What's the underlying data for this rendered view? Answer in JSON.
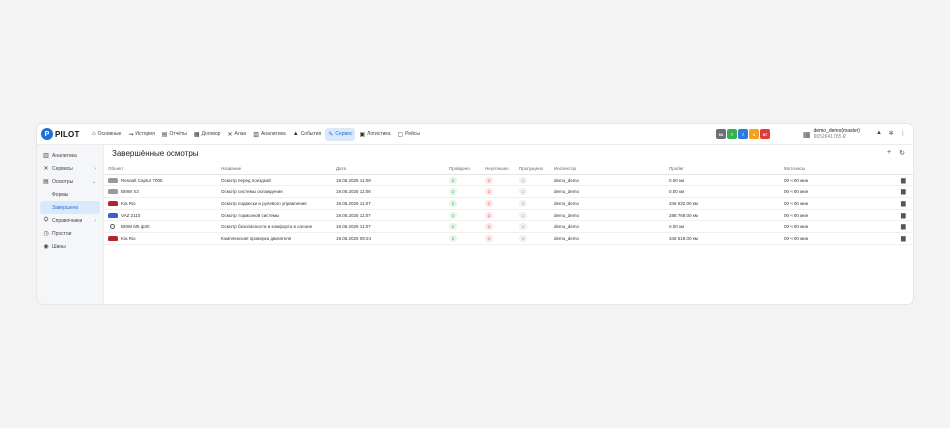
{
  "logo": {
    "mark": "P",
    "text": "PILOT"
  },
  "nav": [
    {
      "icon": "home-icon",
      "glyph": "⌂",
      "label": "Основные"
    },
    {
      "icon": "route-icon",
      "glyph": "⇝",
      "label": "История"
    },
    {
      "icon": "document-icon",
      "glyph": "▤",
      "label": "Отчёты"
    },
    {
      "icon": "contract-icon",
      "glyph": "▦",
      "label": "Договор"
    },
    {
      "icon": "tools-icon",
      "glyph": "✕",
      "label": "Алан"
    },
    {
      "icon": "analytics-icon",
      "glyph": "▥",
      "label": "Аналитика"
    },
    {
      "icon": "bell-icon",
      "glyph": "▲",
      "label": "События"
    },
    {
      "icon": "wrench-icon",
      "glyph": "✎",
      "label": "Сервис",
      "active": true
    },
    {
      "icon": "truck-icon",
      "glyph": "▣",
      "label": "Логистика"
    },
    {
      "icon": "bus-icon",
      "glyph": "▢",
      "label": "Рейсы"
    }
  ],
  "badges": [
    {
      "text": "6h",
      "color": "#6b6f78"
    },
    {
      "text": "7",
      "color": "#35b34a"
    },
    {
      "text": "7",
      "color": "#2d7be0"
    },
    {
      "text": "4",
      "color": "#f2a31a"
    },
    {
      "text": "87",
      "color": "#e33b3b"
    }
  ],
  "user": {
    "name": "demo_demo(master)",
    "balance": "9652641785 ₽"
  },
  "sidebar": [
    {
      "icon": "analytics-icon",
      "glyph": "▥",
      "label": "Аналитика"
    },
    {
      "icon": "tools-icon",
      "glyph": "✕",
      "label": "Сервисы",
      "chevron": "›"
    },
    {
      "icon": "document-icon",
      "glyph": "▤",
      "label": "Осмотры",
      "chevron": "⌄"
    },
    {
      "label": "Формы",
      "sub": true
    },
    {
      "label": "Завершено",
      "sub": true,
      "selected": true
    },
    {
      "icon": "directory-icon",
      "glyph": "⛭",
      "label": "Справочники",
      "chevron": "›"
    },
    {
      "icon": "clock-icon",
      "glyph": "◷",
      "label": "Простои"
    },
    {
      "icon": "tire-icon",
      "glyph": "◉",
      "label": "Шины"
    }
  ],
  "page": {
    "title": "Завершённые осмотры",
    "add": "+",
    "refresh": "↻"
  },
  "table": {
    "headers": [
      "Объект",
      "Название",
      "Дата",
      "Пройдено",
      "Неуспешно",
      "Пропущено",
      "Инспектор",
      "Пробег",
      "Моточасы"
    ],
    "rows": [
      {
        "car_color": "#9a9a9a",
        "object": "Renault Captur 7005",
        "name": "Осмотр перед поездкой",
        "date": "19.05.2025 11:09",
        "passed": "2",
        "failed": "2",
        "skipped": "1",
        "inspector": "demo_demo",
        "mileage": "0.00 км",
        "hours": "00 ч 00 мин"
      },
      {
        "car_color": "#9a9a9a",
        "object": "BMW X3",
        "name": "Осмотр системы охлаждения",
        "date": "19.05.2025 11:08",
        "passed": "2",
        "failed": "2",
        "skipped": "1",
        "inspector": "demo_demo",
        "mileage": "0.00 км",
        "hours": "00 ч 00 мин"
      },
      {
        "car_color": "#b3242b",
        "object": "Kia Rio",
        "name": "Осмотр подвески и рулевого управления",
        "date": "19.05.2025 11:07",
        "passed": "2",
        "failed": "2",
        "skipped": "1",
        "inspector": "demo_demo",
        "mileage": "346 532.00 км",
        "hours": "00 ч 00 мин"
      },
      {
        "car_color": "#3a62c9",
        "object": "VAZ 2110",
        "name": "Осмотр тормозной системы",
        "date": "19.05.2025 11:07",
        "passed": "2",
        "failed": "2",
        "skipped": "1",
        "inspector": "demo_demo",
        "mileage": "288 769.00 км",
        "hours": "00 ч 00 мин"
      },
      {
        "car_color": "#ffffff",
        "object": "BMW M5 ф30",
        "name": "Осмотр безопасности и комфорта в салоне",
        "date": "19.05.2025 11:07",
        "passed": "2",
        "failed": "2",
        "skipped": "1",
        "inspector": "demo_demo",
        "mileage": "0.00 км",
        "hours": "00 ч 00 мин"
      },
      {
        "car_color": "#b3242b",
        "object": "Kia Rio",
        "name": "Комплексная проверка двигателя",
        "date": "19.05.2025 09:24",
        "passed": "2",
        "failed": "1",
        "skipped": "1",
        "inspector": "demo_demo",
        "mileage": "346 519.00 км",
        "hours": "00 ч 00 мин"
      }
    ]
  }
}
